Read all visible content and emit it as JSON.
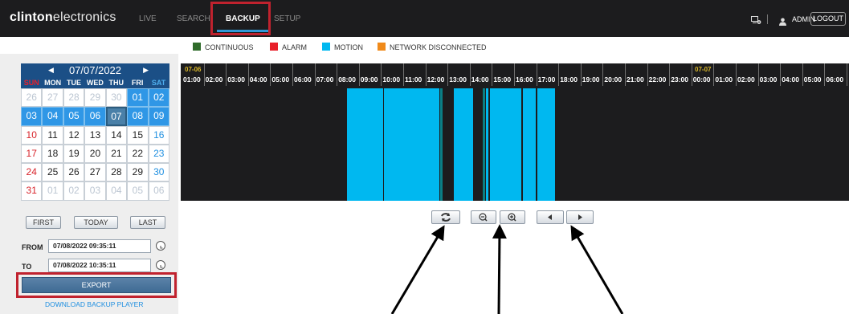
{
  "brand": {
    "bold": "clinton",
    "regular": "electronics"
  },
  "nav": {
    "live": "LIVE",
    "search": "SEARCH",
    "backup": "BACKUP",
    "setup": "SETUP"
  },
  "user": {
    "name": "ADMIN",
    "logout": "LOGOUT"
  },
  "legend": {
    "continuous": "CONTINUOUS",
    "alarm": "ALARM",
    "motion": "MOTION",
    "network": "NETWORK DISCONNECTED",
    "colors": {
      "continuous": "#2f6b2a",
      "alarm": "#e8202a",
      "motion": "#00b8f0",
      "network": "#f08a1a"
    }
  },
  "calendar": {
    "month_label": "07/07/2022",
    "weekdays": [
      "SUN",
      "MON",
      "TUE",
      "WED",
      "THU",
      "FRI",
      "SAT"
    ],
    "days": [
      "26",
      "27",
      "28",
      "29",
      "30",
      "01",
      "02",
      "03",
      "04",
      "05",
      "06",
      "07",
      "08",
      "09",
      "10",
      "11",
      "12",
      "13",
      "14",
      "15",
      "16",
      "17",
      "18",
      "19",
      "20",
      "21",
      "22",
      "23",
      "24",
      "25",
      "26",
      "27",
      "28",
      "29",
      "30",
      "31",
      "01",
      "02",
      "03",
      "04",
      "05",
      "06"
    ],
    "first": "FIRST",
    "today": "TODAY",
    "last": "LAST"
  },
  "range": {
    "from_label": "FROM",
    "from_value": "07/08/2022 09:35:11",
    "to_label": "TO",
    "to_value": "07/08/2022 10:35:11"
  },
  "export": "EXPORT",
  "download_link": "DOWNLOAD BACKUP PLAYER",
  "timeline": {
    "date_start": "07-06",
    "date_next": "07-07",
    "hours": [
      "01:00",
      "02:00",
      "03:00",
      "04:00",
      "05:00",
      "06:00",
      "07:00",
      "08:00",
      "09:00",
      "10:00",
      "11:00",
      "12:00",
      "13:00",
      "14:00",
      "15:00",
      "16:00",
      "17:00",
      "18:00",
      "19:00",
      "20:00",
      "21:00",
      "22:00",
      "23:00",
      "00:00",
      "01:00",
      "02:00",
      "03:00",
      "04:00",
      "05:00",
      "06:00"
    ]
  },
  "icons": {
    "refresh": "refresh-icon",
    "zoom_out": "zoom-out-icon",
    "zoom_in": "zoom-in-icon",
    "prev": "prev-icon",
    "next": "next-icon",
    "monitor": "monitor-gear-icon",
    "user": "user-icon",
    "clock": "clock-icon"
  }
}
